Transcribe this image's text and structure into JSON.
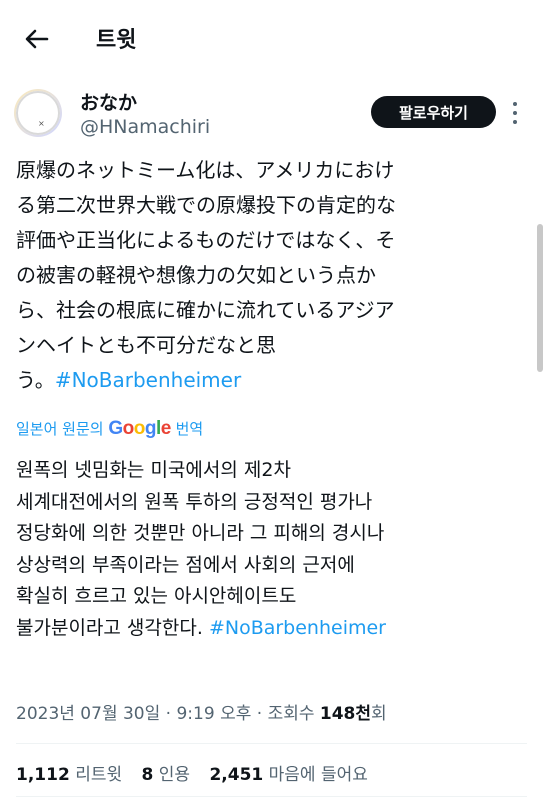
{
  "header": {
    "title": "트윗"
  },
  "author": {
    "display_name": "おなか",
    "handle": "@HNamachiri",
    "follow_label": "팔로우하기"
  },
  "tweet": {
    "lines": [
      "原爆のネットミーム化は、アメリカにおけ",
      "る第二次世界大戦での原爆投下の肯定的な",
      "評価や正当化によるものだけではなく、そ",
      "の被害の軽視や想像力の欠如という点か",
      "ら、社会の根底に確かに流れているアジア",
      "ンヘイトとも不可分だなと思"
    ],
    "last_line_prefix": "う。",
    "hashtag": "#NoBarbenheimer"
  },
  "translation_credit": {
    "prefix": "일본어 원문의",
    "google": "Google",
    "suffix": "번역"
  },
  "translation": {
    "lines": [
      "원폭의 넷밈화는 미국에서의 제2차",
      "세계대전에서의 원폭 투하의 긍정적인 평가나",
      "정당화에 의한 것뿐만 아니라 그 피해의 경시나",
      "상상력의 부족이라는 점에서 사회의 근저에",
      "확실히 흐르고 있는 아시안헤이트도"
    ],
    "last_line_prefix": "불가분이라고 생각한다.",
    "hashtag": "#NoBarbenheimer"
  },
  "meta": {
    "date": "2023년 07월 30일",
    "sep1": " · ",
    "time": "9:19 오후",
    "sep2": " · ",
    "views_label": "조회수",
    "views_count": "148천",
    "views_suffix": "회"
  },
  "stats": {
    "retweets_count": "1,112",
    "retweets_label": "리트윗",
    "quotes_count": "8",
    "quotes_label": "인용",
    "likes_count": "2,451",
    "likes_label": "마음에 들어요"
  }
}
